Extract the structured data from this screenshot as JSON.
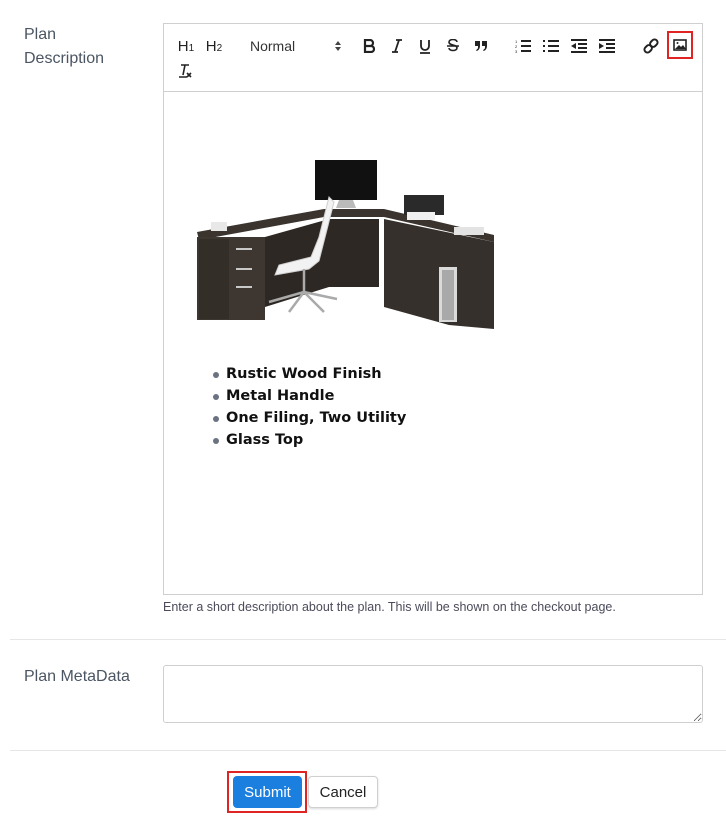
{
  "form": {
    "description_label_line1": "Plan",
    "description_label_line2": "Description",
    "metadata_label": "Plan MetaData",
    "help_text": "Enter a short description about the plan. This will be shown on the checkout page.",
    "metadata_value": "",
    "submit_label": "Submit",
    "cancel_label": "Cancel",
    "submit_color": "#1b7fe0",
    "highlight_color": "#e02424"
  },
  "toolbar": {
    "h1": "H1",
    "h2": "H2",
    "format_select": "Normal",
    "buttons": [
      "bold",
      "italic",
      "underline",
      "strikethrough",
      "blockquote",
      "ordered-list",
      "bullet-list",
      "outdent",
      "indent",
      "link",
      "image",
      "clear-formatting"
    ],
    "active_button": "image"
  },
  "editor": {
    "image_alt": "L-shaped dark wood office desk with white chair, monitor and printer",
    "bullets": [
      "Rustic Wood Finish",
      "Metal Handle",
      "One Filing, Two Utility",
      "Glass Top"
    ]
  }
}
